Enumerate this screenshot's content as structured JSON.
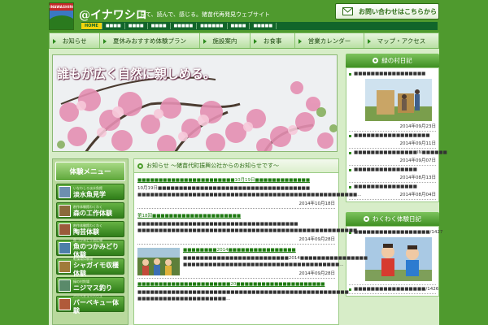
{
  "header": {
    "logo_text": "INAWASHIRO",
    "brand": "@イナワシロ",
    "tagline": "見て、読んで、感じる。猪苗代再発見ウェブサイト",
    "contact_label": "お問い合わせはこちらから"
  },
  "subnav": [
    "HOME",
    "■■■■",
    "■■■■",
    "■■■■",
    "■■■■■",
    "■■■■■■",
    "■■■■",
    "■■■■■"
  ],
  "mainnav": [
    "お知らせ",
    "夏休みおすすめ体験プラン",
    "施設案内",
    "お食事",
    "営業カレンダー",
    "マップ・アクセス"
  ],
  "hero": {
    "title": "誰もが広く自然に親しめる。"
  },
  "left_menu": {
    "title": "体験メニュー",
    "items": [
      {
        "small": "いなわしろ淡水魚館",
        "big": "淡水魚見学"
      },
      {
        "small": "創作体験館わくわく",
        "big": "森の工作体験"
      },
      {
        "small": "創作体験館わくわく",
        "big": "陶芸体験"
      },
      {
        "small": "魚つかみどり池広場",
        "big": "魚のつかみどり体験"
      },
      {
        "small": "乾燥場体験場",
        "big": "シャガイモ収穫体験"
      },
      {
        "small": "緑の村釣場",
        "big": "ニジマス釣り"
      },
      {
        "small": "バーベキューハウス",
        "big": "バーベキュー体験"
      }
    ]
  },
  "news": {
    "title": "お知らせ ～猪苗代町振興公社からのお知らせです～",
    "items": [
      {
        "heading": "■■■■■■■■■■■■■■■■■■■■■■■10月19日■■■■■■■■■■■■■",
        "body": "10月19日■■■■■■■■■■■■■■■■■■■■■■■■■■■■■■■■■■■■ ■■■■■■■■■■■■■■■■■■■■■■■■■■■■■■■■■■■■■■■■■■■■■■■■■■■■...",
        "date": "2014年10月18日"
      },
      {
        "heading": "第18回■■■■■■■■■■■■■■■■■■■■■",
        "body": "■■■■■■■■■■■■■■■■■■■■■■■■■■■■■■■■■■■■■■ ■■■■■■■■■■■■■■■■■■■■■■■■■■■■■■■■■■■■■■■■■■■■■■■■■■■■...",
        "date": "2014年09月28日"
      },
      {
        "heading": "■■■■■■■■2014■■■■■■■■■■■■■■■■",
        "body": "■■■■■■■■■■■■■■■■■■■■■■■■■2014■■■■■■■■■■■■■■■■ ■■■■■■■■■■■■■■■■■■■■■■■■■■■■■■■■■■■■■...",
        "date": "2014年09月28日"
      },
      {
        "heading": "■■■■■■■■■■■■■■■■■■■■■■20■■■■■■■■■■■■■■■■■■■■■",
        "body": "■■■■■■■■■■■■■■■■■■■■■■■■■■■■■■■■■■■■■■■■■■■■■■■■■■ ■■■■■■■■■■■■■■■■■■■■■...",
        "date": ""
      }
    ]
  },
  "right": {
    "village_title": "緑の村日記",
    "village_items": [
      {
        "text": "■■■■■■■■■■■■■■■■■",
        "date": "2014年09月23日"
      },
      {
        "text": "■■■■■■■■■■■■■■■■■■",
        "date": "2014年09月11日"
      },
      {
        "text": "■■■■■■■■■■■■■■■IN■■■■■■",
        "date": "2014年09月07日"
      },
      {
        "text": "■■■■■■■■■■■■■■■",
        "date": "2014年08月13日"
      },
      {
        "text": "■■■■■■■■■■■■■■■",
        "date": "2014年08月04日"
      }
    ],
    "waku_title": "わくわく体験日記",
    "waku_items": [
      {
        "text": "■■■■■■■■■■■■■■■■■■/1427"
      },
      {
        "text": "■■■■■■■■■■■■■■■■■/1426"
      }
    ]
  },
  "colors": {
    "brand_green": "#4f9a2e",
    "subnav_green": "#11652a",
    "active_yellow": "#f4d40c"
  }
}
